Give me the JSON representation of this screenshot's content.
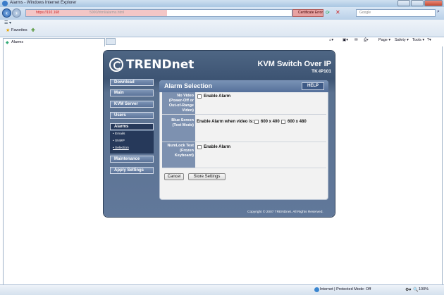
{
  "browser": {
    "window_title": "Alarms - Windows Internet Explorer",
    "address_https": "https://192.168",
    "address_rest": "5000/html/alarms.html",
    "certificate_error": "Certificate Error",
    "search_placeholder": "Google",
    "favorites_label": "Favorites",
    "tab_title": "Alarms",
    "commands": {
      "page": "Page ▾",
      "safety": "Safety ▾",
      "tools": "Tools ▾"
    },
    "status_zone": "Internet | Protected Mode: Off",
    "zoom": "100%"
  },
  "app": {
    "logo": "TRENDnet",
    "product_title": "KVM Switch Over IP",
    "model": "TK-IP101",
    "nav": {
      "download": "Download",
      "main": "Main",
      "kvm_server": "KVM Server",
      "users": "Users",
      "alarms": "Alarms",
      "sub": {
        "emails": "Emails",
        "snmp": "SNMP",
        "selection": "Selection"
      },
      "maintenance": "Maintenance",
      "apply_settings": "Apply Settings"
    },
    "section_title": "Alarm Selection",
    "help": "HELP",
    "rows": {
      "no_video": {
        "label": [
          "No Video",
          "(Power-Off or",
          "Out-of-Range",
          "Video)"
        ],
        "option": "Enable Alarm"
      },
      "blue_screen": {
        "label": [
          "Blue Screen",
          "(Text Mode)"
        ],
        "prefix": "Enable Alarm when video is:",
        "opt1": "600 x 400",
        "opt2": "600 x 480"
      },
      "numlock": {
        "label": [
          "NumLock Test",
          "(Frozen",
          "Keyboard)"
        ],
        "option": "Enable Alarm"
      }
    },
    "cancel": "Cancel",
    "store": "Store Settings",
    "copyright": "Copyright © 2007 TRENDnet. All Rights Reserved."
  }
}
